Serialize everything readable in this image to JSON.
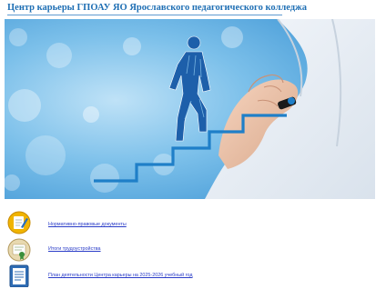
{
  "header": {
    "title": "Центр карьеры ГПОАУ ЯО Ярославского педагогического колледжа"
  },
  "banner": {
    "image": "man-drawing-staircase-with-climbing-figure",
    "accent_color": "#1f7fc8"
  },
  "documents": {
    "items": [
      {
        "label": "Нормативно-правовые документы",
        "icon": "pencil-note-icon"
      },
      {
        "label": "Итоги трудоустройства",
        "icon": "certificate-icon"
      },
      {
        "label": "План деятельности Центра карьеры на 2025-2026 учебный год",
        "icon": "document-list-icon"
      }
    ]
  }
}
